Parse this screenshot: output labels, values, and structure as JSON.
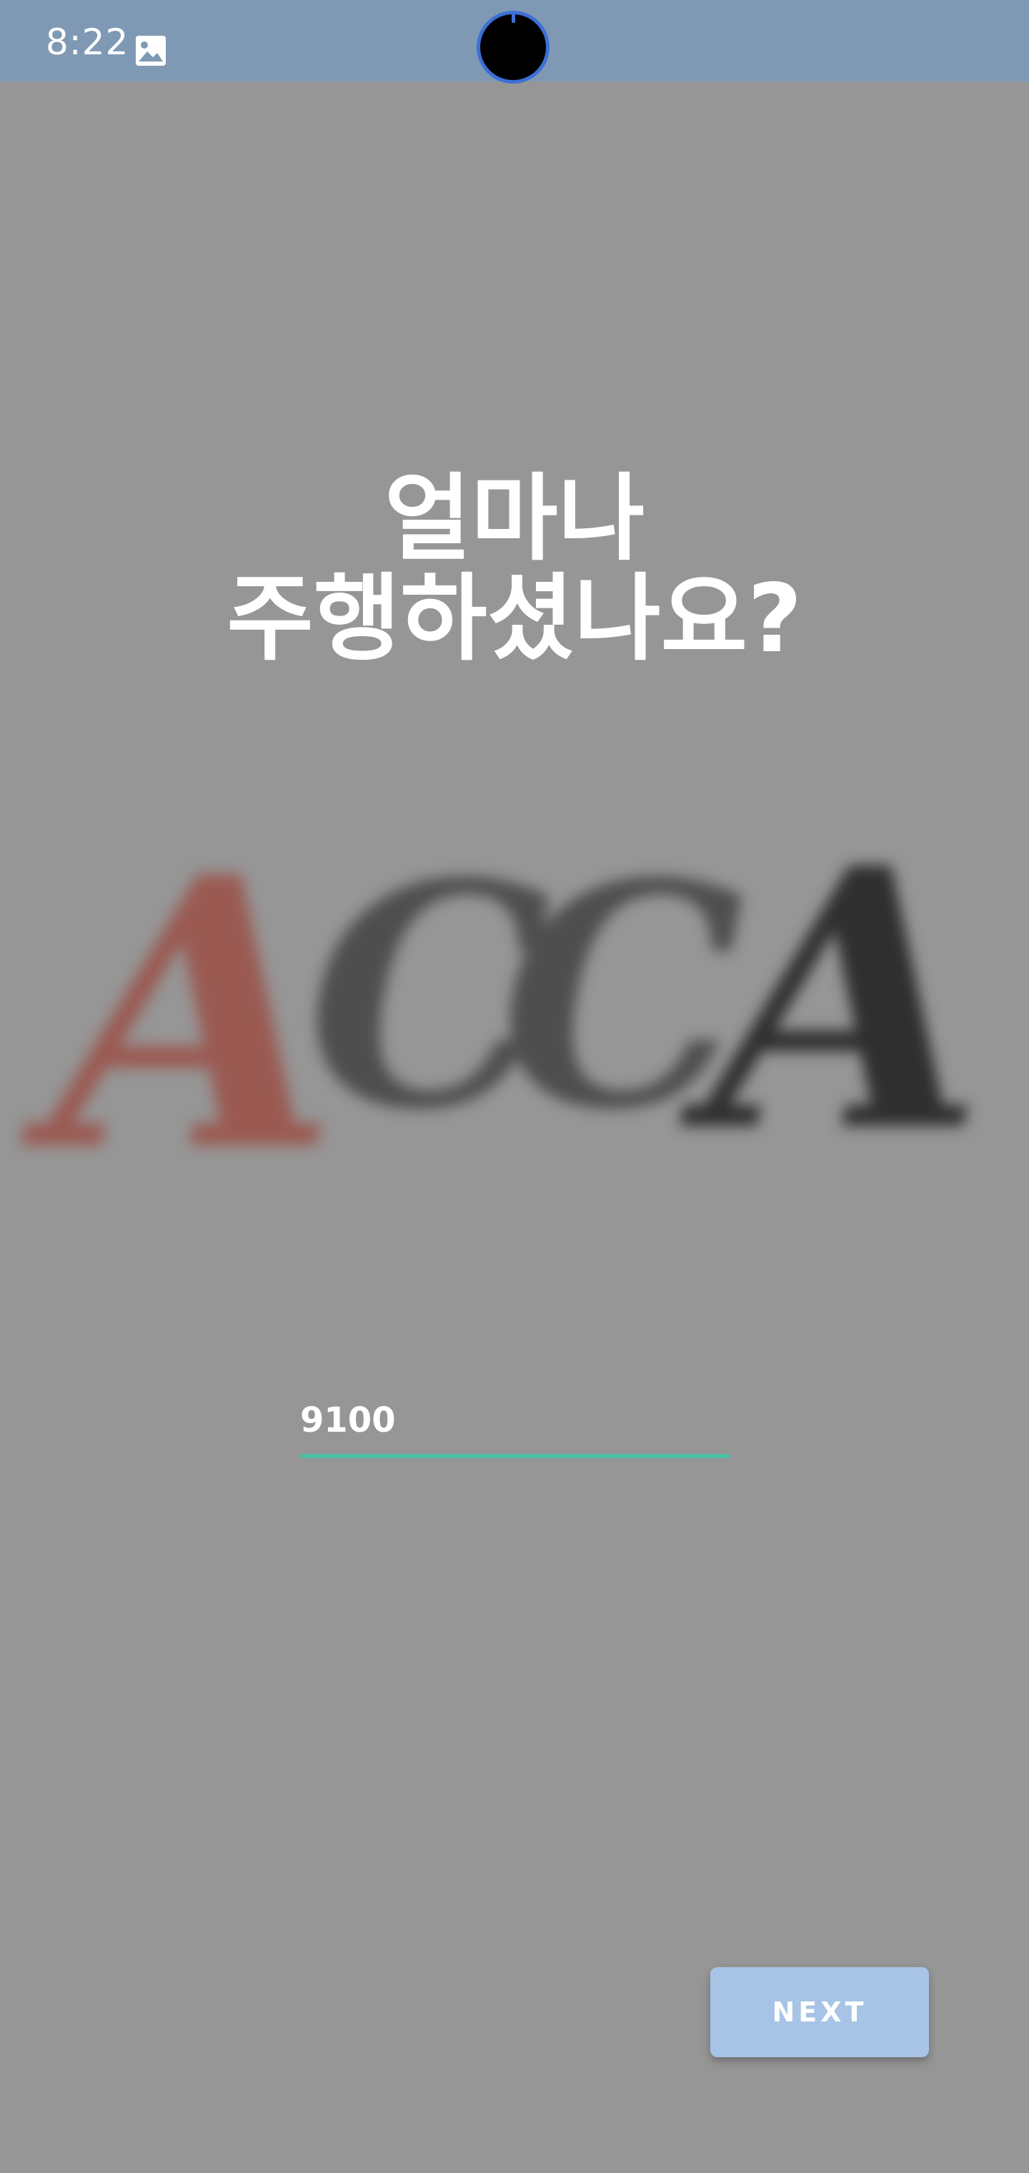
{
  "status_bar": {
    "time": "8:22",
    "notification_icon": "image-icon",
    "color": "#7f99b5"
  },
  "headline": {
    "line1": "얼마나",
    "line2": "주행하셨나요?"
  },
  "logo": {
    "letters": [
      "A",
      "C",
      "C",
      "A"
    ],
    "colors": {
      "first_letter": "#9a5a52",
      "other_letters": "#4e4e4e"
    }
  },
  "mileage_input": {
    "value": "9100",
    "underline_color": "#4dbfa4"
  },
  "next_button": {
    "label": "NEXT",
    "color": "#a7c4e6"
  },
  "colors": {
    "background": "#969696",
    "text": "#ffffff"
  }
}
